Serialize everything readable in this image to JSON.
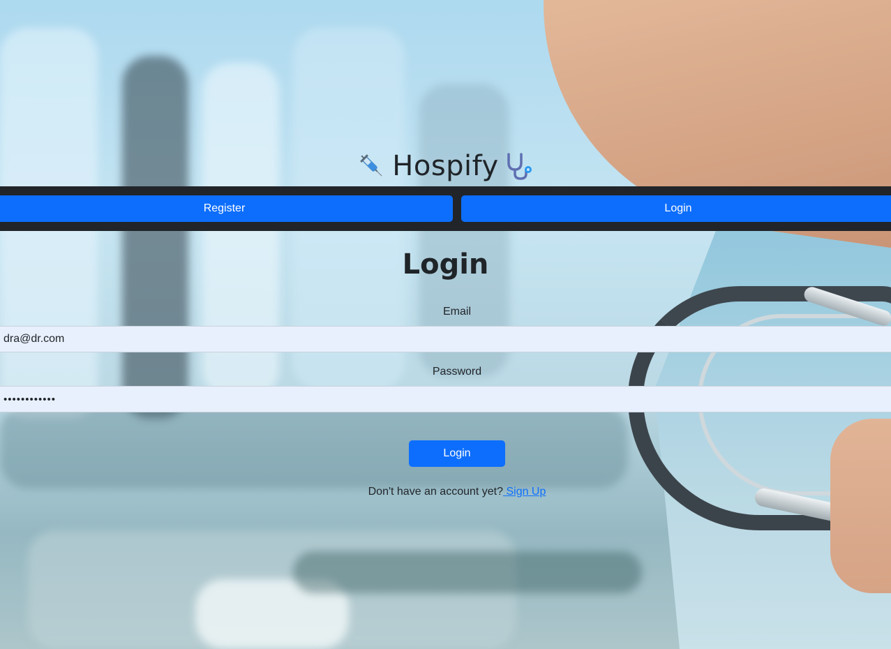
{
  "app": {
    "title": "Hospify",
    "brand_left_icon": "syringe-icon",
    "brand_right_icon": "stethoscope-icon"
  },
  "navbar": {
    "register_label": "Register",
    "login_label": "Login",
    "button_color": "#0d6efd",
    "bar_color": "#212529"
  },
  "form": {
    "title": "Login",
    "email_label": "Email",
    "email_value": "dra@dr.com",
    "password_label": "Password",
    "password_value": "••••••••••••",
    "submit_label": "Login",
    "signup_prompt": "Don't have an account yet?",
    "signup_link": " Sign Up"
  }
}
